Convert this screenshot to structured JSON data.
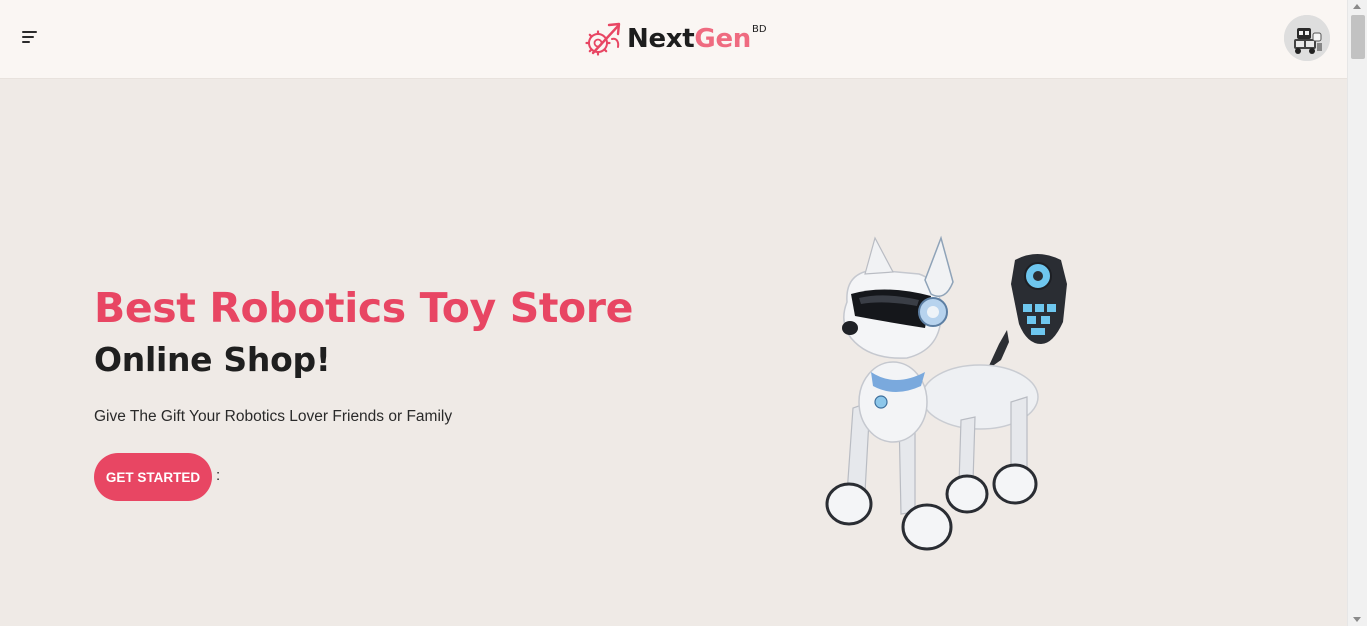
{
  "header": {
    "menu_icon": "hamburger-menu-icon",
    "brand": {
      "logo_icon": "robot-gear-logo-icon",
      "name_part1": "Next",
      "name_part2": "Gen",
      "superscript": "BD"
    },
    "avatar_icon": "robot-avatar-icon"
  },
  "hero": {
    "title": "Best Robotics Toy Store",
    "subtitle": "Online Shop!",
    "description": "Give The Gift Your Robotics Lover Friends or Family",
    "cta_label": "GET STARTED",
    "cta_suffix": ":",
    "image": "robot-dog-with-remote-image"
  },
  "colors": {
    "accent": "#e84663",
    "brand_pink": "#ef6b80",
    "header_bg": "#faf6f3",
    "page_bg": "#efeae6",
    "text_dark": "#1f1f1f"
  }
}
